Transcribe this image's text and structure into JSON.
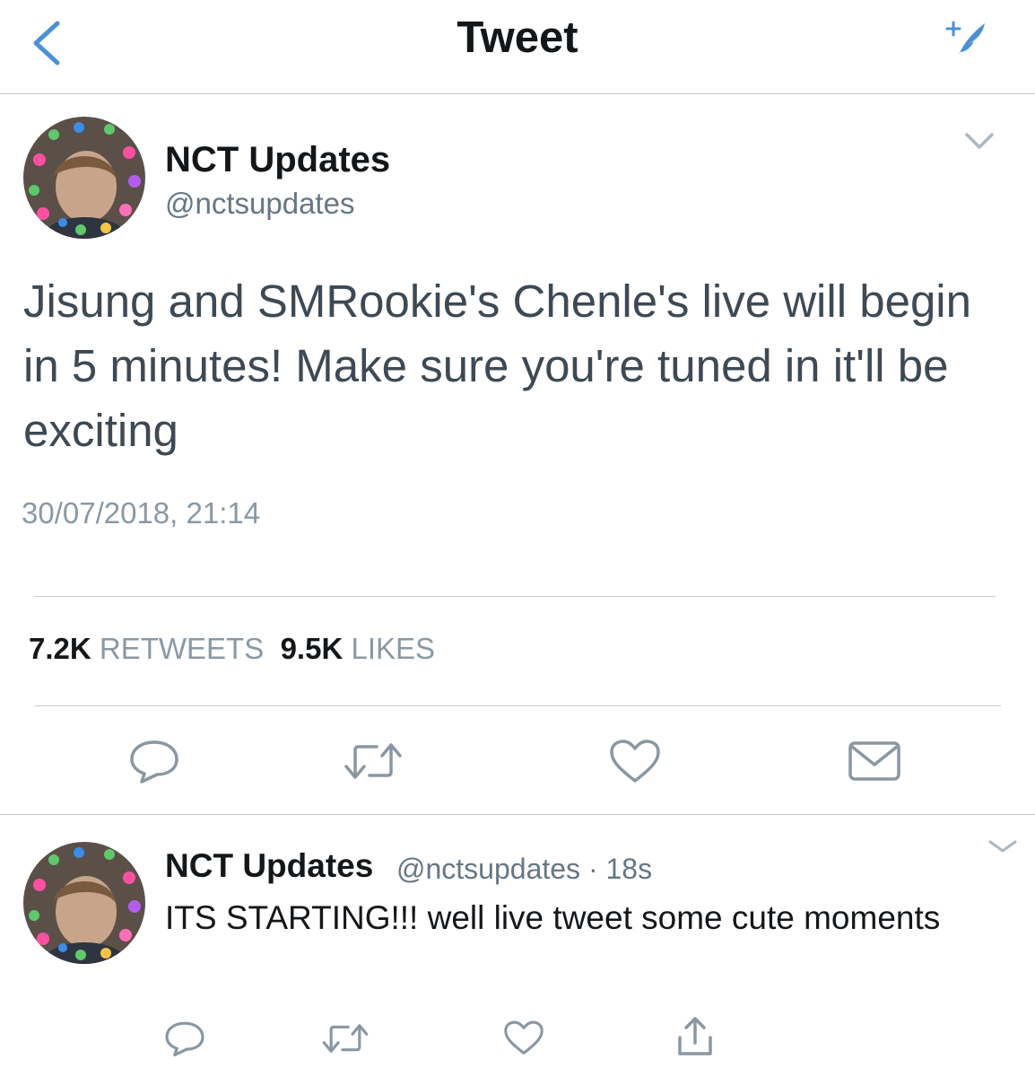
{
  "nav": {
    "title": "Tweet",
    "back_icon": "chevron-left-icon",
    "compose_icon": "compose-feather-icon",
    "accent_color": "#4a90d9"
  },
  "tweet": {
    "author_name": "NCT Updates",
    "author_handle": "@nctsupdates",
    "text": "Jisung and SMRookie's Chenle's live will begin in 5 minutes! Make sure you're tuned in it'll be exciting",
    "timestamp": "30/07/2018, 21:14",
    "retweets_count": "7.2K",
    "retweets_label": "RETWEETS",
    "likes_count": "9.5K",
    "likes_label": "LIKES",
    "actions": [
      "reply-icon",
      "retweet-icon",
      "like-icon",
      "message-icon"
    ]
  },
  "reply": {
    "author_name": "NCT Updates",
    "author_handle": "@nctsupdates",
    "separator": "·",
    "age": "18s",
    "text": "ITS STARTING!!! well live tweet some cute moments",
    "actions": [
      "reply-icon",
      "retweet-icon",
      "like-icon",
      "share-icon"
    ]
  },
  "colors": {
    "text_primary": "#14171a",
    "text_secondary": "#657786",
    "icon_gray": "#8a97a3",
    "divider": "#c8ccd0"
  }
}
